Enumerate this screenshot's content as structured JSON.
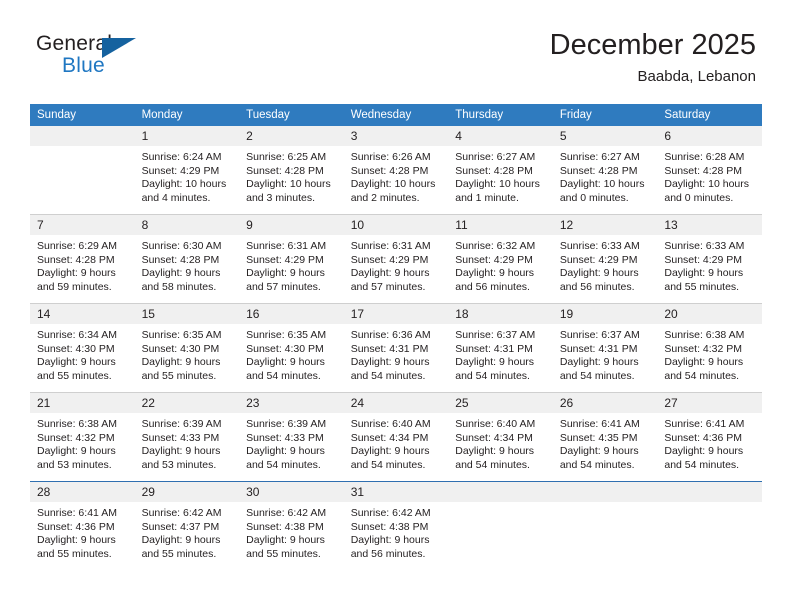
{
  "branding": {
    "logo_text_primary": "General",
    "logo_text_secondary": "Blue",
    "logo_accent_color": "#15629f",
    "logo_secondary_color": "#1f77c2"
  },
  "header": {
    "title": "December 2025",
    "subtitle": "Baabda, Lebanon"
  },
  "theme": {
    "header_band_color": "#2f7bbf",
    "daynum_band_color": "#f0f0f0",
    "text_color": "#231f20"
  },
  "weekday_headers": [
    "Sunday",
    "Monday",
    "Tuesday",
    "Wednesday",
    "Thursday",
    "Friday",
    "Saturday"
  ],
  "labels": {
    "sunrise_prefix": "Sunrise:",
    "sunset_prefix": "Sunset:",
    "daylight_prefix": "Daylight:"
  },
  "weeks": [
    [
      {
        "day": "",
        "sunrise": "",
        "sunset": "",
        "daylight_line1": "",
        "daylight_line2": ""
      },
      {
        "day": "1",
        "sunrise": "Sunrise: 6:24 AM",
        "sunset": "Sunset: 4:29 PM",
        "daylight_line1": "Daylight: 10 hours",
        "daylight_line2": "and 4 minutes."
      },
      {
        "day": "2",
        "sunrise": "Sunrise: 6:25 AM",
        "sunset": "Sunset: 4:28 PM",
        "daylight_line1": "Daylight: 10 hours",
        "daylight_line2": "and 3 minutes."
      },
      {
        "day": "3",
        "sunrise": "Sunrise: 6:26 AM",
        "sunset": "Sunset: 4:28 PM",
        "daylight_line1": "Daylight: 10 hours",
        "daylight_line2": "and 2 minutes."
      },
      {
        "day": "4",
        "sunrise": "Sunrise: 6:27 AM",
        "sunset": "Sunset: 4:28 PM",
        "daylight_line1": "Daylight: 10 hours",
        "daylight_line2": "and 1 minute."
      },
      {
        "day": "5",
        "sunrise": "Sunrise: 6:27 AM",
        "sunset": "Sunset: 4:28 PM",
        "daylight_line1": "Daylight: 10 hours",
        "daylight_line2": "and 0 minutes."
      },
      {
        "day": "6",
        "sunrise": "Sunrise: 6:28 AM",
        "sunset": "Sunset: 4:28 PM",
        "daylight_line1": "Daylight: 10 hours",
        "daylight_line2": "and 0 minutes."
      }
    ],
    [
      {
        "day": "7",
        "sunrise": "Sunrise: 6:29 AM",
        "sunset": "Sunset: 4:28 PM",
        "daylight_line1": "Daylight: 9 hours",
        "daylight_line2": "and 59 minutes."
      },
      {
        "day": "8",
        "sunrise": "Sunrise: 6:30 AM",
        "sunset": "Sunset: 4:28 PM",
        "daylight_line1": "Daylight: 9 hours",
        "daylight_line2": "and 58 minutes."
      },
      {
        "day": "9",
        "sunrise": "Sunrise: 6:31 AM",
        "sunset": "Sunset: 4:29 PM",
        "daylight_line1": "Daylight: 9 hours",
        "daylight_line2": "and 57 minutes."
      },
      {
        "day": "10",
        "sunrise": "Sunrise: 6:31 AM",
        "sunset": "Sunset: 4:29 PM",
        "daylight_line1": "Daylight: 9 hours",
        "daylight_line2": "and 57 minutes."
      },
      {
        "day": "11",
        "sunrise": "Sunrise: 6:32 AM",
        "sunset": "Sunset: 4:29 PM",
        "daylight_line1": "Daylight: 9 hours",
        "daylight_line2": "and 56 minutes."
      },
      {
        "day": "12",
        "sunrise": "Sunrise: 6:33 AM",
        "sunset": "Sunset: 4:29 PM",
        "daylight_line1": "Daylight: 9 hours",
        "daylight_line2": "and 56 minutes."
      },
      {
        "day": "13",
        "sunrise": "Sunrise: 6:33 AM",
        "sunset": "Sunset: 4:29 PM",
        "daylight_line1": "Daylight: 9 hours",
        "daylight_line2": "and 55 minutes."
      }
    ],
    [
      {
        "day": "14",
        "sunrise": "Sunrise: 6:34 AM",
        "sunset": "Sunset: 4:30 PM",
        "daylight_line1": "Daylight: 9 hours",
        "daylight_line2": "and 55 minutes."
      },
      {
        "day": "15",
        "sunrise": "Sunrise: 6:35 AM",
        "sunset": "Sunset: 4:30 PM",
        "daylight_line1": "Daylight: 9 hours",
        "daylight_line2": "and 55 minutes."
      },
      {
        "day": "16",
        "sunrise": "Sunrise: 6:35 AM",
        "sunset": "Sunset: 4:30 PM",
        "daylight_line1": "Daylight: 9 hours",
        "daylight_line2": "and 54 minutes."
      },
      {
        "day": "17",
        "sunrise": "Sunrise: 6:36 AM",
        "sunset": "Sunset: 4:31 PM",
        "daylight_line1": "Daylight: 9 hours",
        "daylight_line2": "and 54 minutes."
      },
      {
        "day": "18",
        "sunrise": "Sunrise: 6:37 AM",
        "sunset": "Sunset: 4:31 PM",
        "daylight_line1": "Daylight: 9 hours",
        "daylight_line2": "and 54 minutes."
      },
      {
        "day": "19",
        "sunrise": "Sunrise: 6:37 AM",
        "sunset": "Sunset: 4:31 PM",
        "daylight_line1": "Daylight: 9 hours",
        "daylight_line2": "and 54 minutes."
      },
      {
        "day": "20",
        "sunrise": "Sunrise: 6:38 AM",
        "sunset": "Sunset: 4:32 PM",
        "daylight_line1": "Daylight: 9 hours",
        "daylight_line2": "and 54 minutes."
      }
    ],
    [
      {
        "day": "21",
        "sunrise": "Sunrise: 6:38 AM",
        "sunset": "Sunset: 4:32 PM",
        "daylight_line1": "Daylight: 9 hours",
        "daylight_line2": "and 53 minutes."
      },
      {
        "day": "22",
        "sunrise": "Sunrise: 6:39 AM",
        "sunset": "Sunset: 4:33 PM",
        "daylight_line1": "Daylight: 9 hours",
        "daylight_line2": "and 53 minutes."
      },
      {
        "day": "23",
        "sunrise": "Sunrise: 6:39 AM",
        "sunset": "Sunset: 4:33 PM",
        "daylight_line1": "Daylight: 9 hours",
        "daylight_line2": "and 54 minutes."
      },
      {
        "day": "24",
        "sunrise": "Sunrise: 6:40 AM",
        "sunset": "Sunset: 4:34 PM",
        "daylight_line1": "Daylight: 9 hours",
        "daylight_line2": "and 54 minutes."
      },
      {
        "day": "25",
        "sunrise": "Sunrise: 6:40 AM",
        "sunset": "Sunset: 4:34 PM",
        "daylight_line1": "Daylight: 9 hours",
        "daylight_line2": "and 54 minutes."
      },
      {
        "day": "26",
        "sunrise": "Sunrise: 6:41 AM",
        "sunset": "Sunset: 4:35 PM",
        "daylight_line1": "Daylight: 9 hours",
        "daylight_line2": "and 54 minutes."
      },
      {
        "day": "27",
        "sunrise": "Sunrise: 6:41 AM",
        "sunset": "Sunset: 4:36 PM",
        "daylight_line1": "Daylight: 9 hours",
        "daylight_line2": "and 54 minutes."
      }
    ],
    [
      {
        "day": "28",
        "sunrise": "Sunrise: 6:41 AM",
        "sunset": "Sunset: 4:36 PM",
        "daylight_line1": "Daylight: 9 hours",
        "daylight_line2": "and 55 minutes."
      },
      {
        "day": "29",
        "sunrise": "Sunrise: 6:42 AM",
        "sunset": "Sunset: 4:37 PM",
        "daylight_line1": "Daylight: 9 hours",
        "daylight_line2": "and 55 minutes."
      },
      {
        "day": "30",
        "sunrise": "Sunrise: 6:42 AM",
        "sunset": "Sunset: 4:38 PM",
        "daylight_line1": "Daylight: 9 hours",
        "daylight_line2": "and 55 minutes."
      },
      {
        "day": "31",
        "sunrise": "Sunrise: 6:42 AM",
        "sunset": "Sunset: 4:38 PM",
        "daylight_line1": "Daylight: 9 hours",
        "daylight_line2": "and 56 minutes."
      },
      {
        "day": "",
        "sunrise": "",
        "sunset": "",
        "daylight_line1": "",
        "daylight_line2": ""
      },
      {
        "day": "",
        "sunrise": "",
        "sunset": "",
        "daylight_line1": "",
        "daylight_line2": ""
      },
      {
        "day": "",
        "sunrise": "",
        "sunset": "",
        "daylight_line1": "",
        "daylight_line2": ""
      }
    ]
  ]
}
